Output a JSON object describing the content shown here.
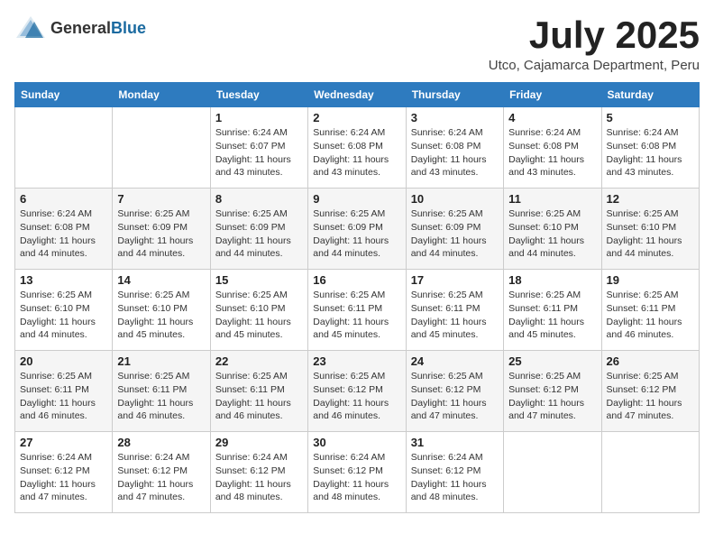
{
  "header": {
    "logo_general": "General",
    "logo_blue": "Blue",
    "month_year": "July 2025",
    "location": "Utco, Cajamarca Department, Peru"
  },
  "days_of_week": [
    "Sunday",
    "Monday",
    "Tuesday",
    "Wednesday",
    "Thursday",
    "Friday",
    "Saturday"
  ],
  "weeks": [
    [
      {
        "day": "",
        "info": ""
      },
      {
        "day": "",
        "info": ""
      },
      {
        "day": "1",
        "info": "Sunrise: 6:24 AM\nSunset: 6:07 PM\nDaylight: 11 hours and 43 minutes."
      },
      {
        "day": "2",
        "info": "Sunrise: 6:24 AM\nSunset: 6:08 PM\nDaylight: 11 hours and 43 minutes."
      },
      {
        "day": "3",
        "info": "Sunrise: 6:24 AM\nSunset: 6:08 PM\nDaylight: 11 hours and 43 minutes."
      },
      {
        "day": "4",
        "info": "Sunrise: 6:24 AM\nSunset: 6:08 PM\nDaylight: 11 hours and 43 minutes."
      },
      {
        "day": "5",
        "info": "Sunrise: 6:24 AM\nSunset: 6:08 PM\nDaylight: 11 hours and 43 minutes."
      }
    ],
    [
      {
        "day": "6",
        "info": "Sunrise: 6:24 AM\nSunset: 6:08 PM\nDaylight: 11 hours and 44 minutes."
      },
      {
        "day": "7",
        "info": "Sunrise: 6:25 AM\nSunset: 6:09 PM\nDaylight: 11 hours and 44 minutes."
      },
      {
        "day": "8",
        "info": "Sunrise: 6:25 AM\nSunset: 6:09 PM\nDaylight: 11 hours and 44 minutes."
      },
      {
        "day": "9",
        "info": "Sunrise: 6:25 AM\nSunset: 6:09 PM\nDaylight: 11 hours and 44 minutes."
      },
      {
        "day": "10",
        "info": "Sunrise: 6:25 AM\nSunset: 6:09 PM\nDaylight: 11 hours and 44 minutes."
      },
      {
        "day": "11",
        "info": "Sunrise: 6:25 AM\nSunset: 6:10 PM\nDaylight: 11 hours and 44 minutes."
      },
      {
        "day": "12",
        "info": "Sunrise: 6:25 AM\nSunset: 6:10 PM\nDaylight: 11 hours and 44 minutes."
      }
    ],
    [
      {
        "day": "13",
        "info": "Sunrise: 6:25 AM\nSunset: 6:10 PM\nDaylight: 11 hours and 44 minutes."
      },
      {
        "day": "14",
        "info": "Sunrise: 6:25 AM\nSunset: 6:10 PM\nDaylight: 11 hours and 45 minutes."
      },
      {
        "day": "15",
        "info": "Sunrise: 6:25 AM\nSunset: 6:10 PM\nDaylight: 11 hours and 45 minutes."
      },
      {
        "day": "16",
        "info": "Sunrise: 6:25 AM\nSunset: 6:11 PM\nDaylight: 11 hours and 45 minutes."
      },
      {
        "day": "17",
        "info": "Sunrise: 6:25 AM\nSunset: 6:11 PM\nDaylight: 11 hours and 45 minutes."
      },
      {
        "day": "18",
        "info": "Sunrise: 6:25 AM\nSunset: 6:11 PM\nDaylight: 11 hours and 45 minutes."
      },
      {
        "day": "19",
        "info": "Sunrise: 6:25 AM\nSunset: 6:11 PM\nDaylight: 11 hours and 46 minutes."
      }
    ],
    [
      {
        "day": "20",
        "info": "Sunrise: 6:25 AM\nSunset: 6:11 PM\nDaylight: 11 hours and 46 minutes."
      },
      {
        "day": "21",
        "info": "Sunrise: 6:25 AM\nSunset: 6:11 PM\nDaylight: 11 hours and 46 minutes."
      },
      {
        "day": "22",
        "info": "Sunrise: 6:25 AM\nSunset: 6:11 PM\nDaylight: 11 hours and 46 minutes."
      },
      {
        "day": "23",
        "info": "Sunrise: 6:25 AM\nSunset: 6:12 PM\nDaylight: 11 hours and 46 minutes."
      },
      {
        "day": "24",
        "info": "Sunrise: 6:25 AM\nSunset: 6:12 PM\nDaylight: 11 hours and 47 minutes."
      },
      {
        "day": "25",
        "info": "Sunrise: 6:25 AM\nSunset: 6:12 PM\nDaylight: 11 hours and 47 minutes."
      },
      {
        "day": "26",
        "info": "Sunrise: 6:25 AM\nSunset: 6:12 PM\nDaylight: 11 hours and 47 minutes."
      }
    ],
    [
      {
        "day": "27",
        "info": "Sunrise: 6:24 AM\nSunset: 6:12 PM\nDaylight: 11 hours and 47 minutes."
      },
      {
        "day": "28",
        "info": "Sunrise: 6:24 AM\nSunset: 6:12 PM\nDaylight: 11 hours and 47 minutes."
      },
      {
        "day": "29",
        "info": "Sunrise: 6:24 AM\nSunset: 6:12 PM\nDaylight: 11 hours and 48 minutes."
      },
      {
        "day": "30",
        "info": "Sunrise: 6:24 AM\nSunset: 6:12 PM\nDaylight: 11 hours and 48 minutes."
      },
      {
        "day": "31",
        "info": "Sunrise: 6:24 AM\nSunset: 6:12 PM\nDaylight: 11 hours and 48 minutes."
      },
      {
        "day": "",
        "info": ""
      },
      {
        "day": "",
        "info": ""
      }
    ]
  ]
}
